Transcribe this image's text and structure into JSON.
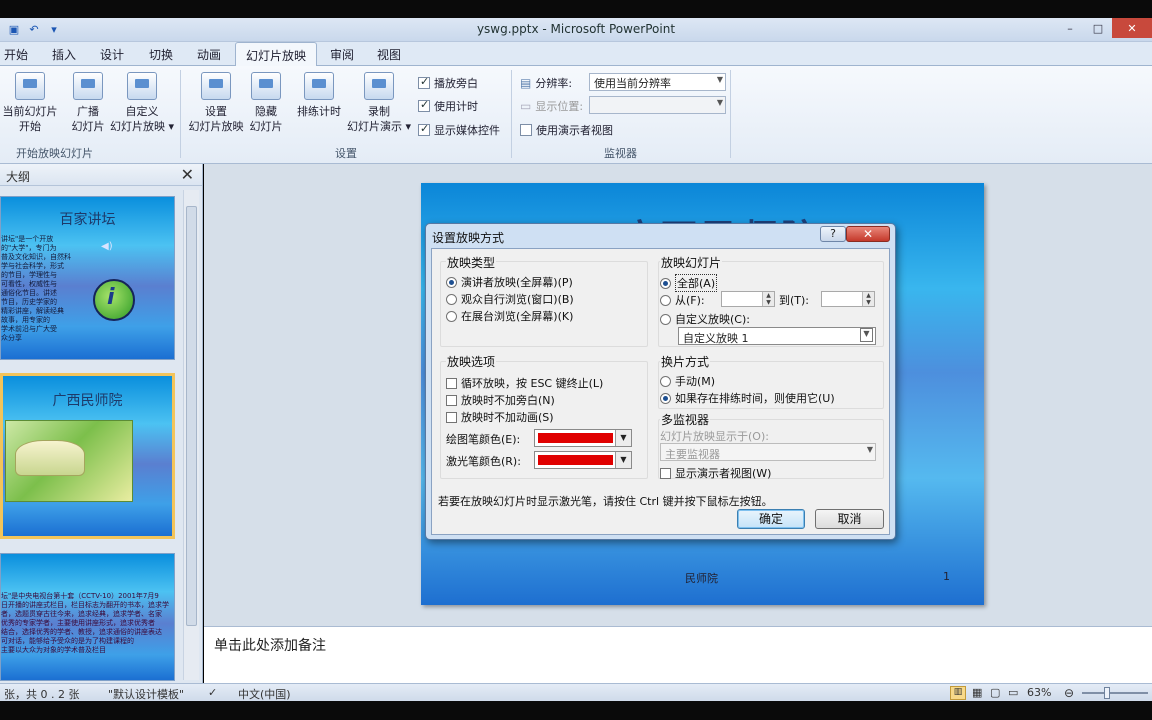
{
  "window": {
    "title": "yswg.pptx - Microsoft PowerPoint",
    "controls": [
      "–",
      "□",
      "✕"
    ]
  },
  "qat": {
    "save_icon": "save-icon",
    "undo_icon": "undo-icon",
    "customize_icon": "dropdown-icon"
  },
  "tabs": [
    "开始",
    "插入",
    "设计",
    "切换",
    "动画",
    "幻灯片放映",
    "审阅",
    "视图"
  ],
  "active_tab": "幻灯片放映",
  "ribbon": {
    "group_start": {
      "label": "开始放映幻灯片",
      "buttons": [
        "当前幻灯片\n开始",
        "广播\n幻灯片",
        "自定义\n幻灯片放映 ▾"
      ]
    },
    "group_setup": {
      "label": "设置",
      "buttons": [
        "设置\n幻灯片放映",
        "隐藏\n幻灯片",
        "排练计时",
        "录制\n幻灯片演示 ▾"
      ],
      "checks": [
        {
          "label": "播放旁白",
          "checked": true
        },
        {
          "label": "使用计时",
          "checked": true
        },
        {
          "label": "显示媒体控件",
          "checked": true
        }
      ]
    },
    "group_monitor": {
      "label": "监视器",
      "resolution_label": "分辨率:",
      "resolution_value": "使用当前分辨率",
      "display_label": "显示位置:",
      "presenter_view_label": "使用演示者视图",
      "presenter_view_checked": false
    }
  },
  "left_panel": {
    "tab": "大纲",
    "slides": [
      {
        "title": "百家讲坛",
        "text": "讲坛\"是一个开放\n的\"大学\"，专门为\n普及文化知识，自然科\n学与社会科学，形式\n的节目，学理性与\n可看性，权威性与\n通俗化节目。讲述\n节目，历史学家的\n精彩讲座，解读经典\n故事，用专家的\n学术前沿与广大受\n众分享"
      },
      {
        "title": "广西民师院",
        "text": ""
      },
      {
        "title": "",
        "text": "坛\"是中央电视台第十套（CCTV-10）2001年7月9\n日开播的讲座式栏目，栏目标志为翻开的书本，追求学\n者，选题贯穿古往今来，追求经典，追求学者、名家\n优秀的专家学者，主要使用讲座形式，追求优秀者\n结合，选择优秀的学者、教授，追求通俗的讲座表达\n可对话，能够给予受众的是为了构建课程的\n主要以大众为对象的学术普及栏目"
      }
    ]
  },
  "slide": {
    "footer_left": "民师院",
    "footer_right": "1",
    "title_partial": "广西民师院"
  },
  "notes": {
    "placeholder": "单击此处添加备注"
  },
  "status": {
    "slide_info": "张，共 0 . 2 张",
    "theme": "\"默认设计模板\"",
    "language": "中文(中国)",
    "zoom": "63%"
  },
  "dialog": {
    "title": "设置放映方式",
    "help": "?",
    "close": "✕",
    "show_type": {
      "label": "放映类型",
      "options": [
        "演讲者放映(全屏幕)(P)",
        "观众自行浏览(窗口)(B)",
        "在展台浏览(全屏幕)(K)"
      ],
      "selected": 0
    },
    "show_slides": {
      "label": "放映幻灯片",
      "all": "全部(A)",
      "from": "从(F):",
      "to": "到(T):",
      "custom": "自定义放映(C):",
      "custom_value": "自定义放映 1",
      "selected": 0
    },
    "show_options": {
      "label": "放映选项",
      "checks": [
        "循环放映，按 ESC 键终止(L)",
        "放映时不加旁白(N)",
        "放映时不加动画(S)"
      ],
      "pen_color": "绘图笔颜色(E):",
      "laser_color": "激光笔颜色(R):",
      "pen_color_hex": "#e00000",
      "laser_color_hex": "#e00000"
    },
    "advance": {
      "label": "换片方式",
      "options": [
        "手动(M)",
        "如果存在排练时间，则使用它(U)"
      ],
      "selected": 1
    },
    "multi_monitor": {
      "label": "多监视器",
      "show_on": "幻灯片放映显示于(O):",
      "monitor_value": "主要监视器",
      "presenter_view": "显示演示者视图(W)"
    },
    "note": "若要在放映幻灯片时显示激光笔，请按住 Ctrl 键并按下鼠标左按钮。",
    "ok": "确定",
    "cancel": "取消"
  }
}
